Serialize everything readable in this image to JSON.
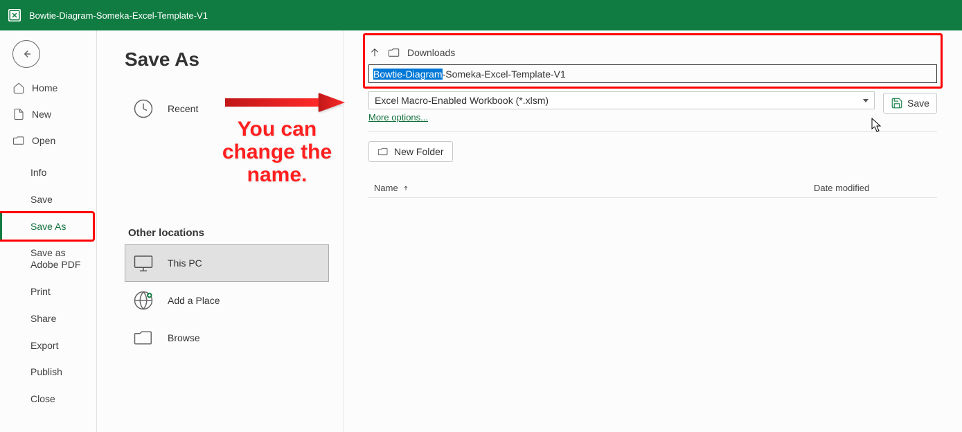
{
  "titlebar": {
    "title": "Bowtie-Diagram-Someka-Excel-Template-V1"
  },
  "sidebar": {
    "home": "Home",
    "new": "New",
    "open": "Open",
    "info": "Info",
    "save": "Save",
    "save_as": "Save As",
    "save_adobe": "Save as Adobe PDF",
    "print": "Print",
    "share": "Share",
    "export": "Export",
    "publish": "Publish",
    "close": "Close"
  },
  "middle": {
    "page_title": "Save As",
    "recent": "Recent",
    "other_locations": "Other locations",
    "this_pc": "This PC",
    "add_place": "Add a Place",
    "browse": "Browse"
  },
  "right": {
    "path": "Downloads",
    "filename_selected": "Bowtie-Diagram",
    "filename_rest": "-Someka-Excel-Template-V1",
    "filetype": "Excel Macro-Enabled Workbook (*.xlsm)",
    "more_options": "More options...",
    "save": "Save",
    "new_folder": "New Folder",
    "col_name": "Name",
    "col_date": "Date modified"
  },
  "annotation": {
    "line1": "You can",
    "line2": "change the",
    "line3": "name."
  }
}
